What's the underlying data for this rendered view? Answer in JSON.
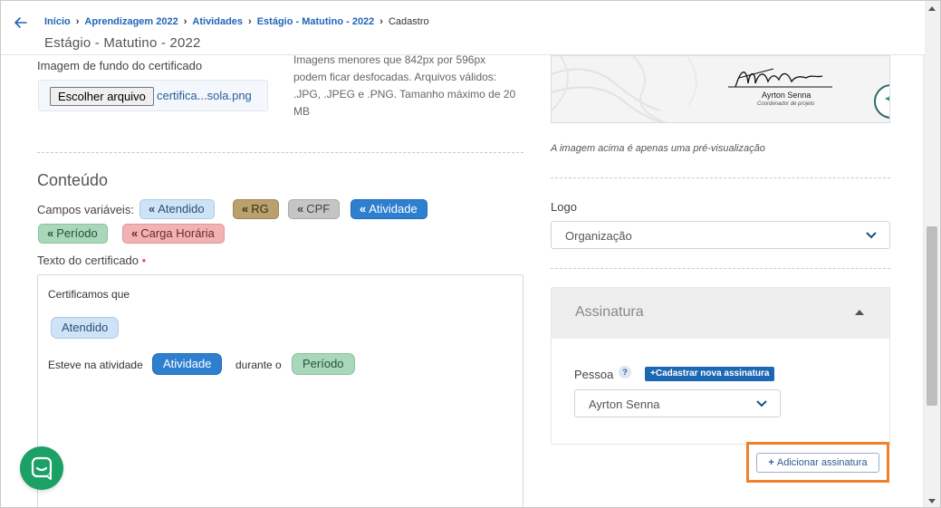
{
  "header": {
    "breadcrumb": [
      "Início",
      "Aprendizagem 2022",
      "Atividades",
      "Estágio - Matutino - 2022"
    ],
    "breadcrumb_current": "Cadastro",
    "title": "Estágio - Matutino - 2022"
  },
  "background_image": {
    "label": "Imagem de fundo do certificado",
    "button": "Escolher arquivo",
    "file_name": "certifica...sola.png",
    "hint": "Imagens menores que 842px por 596px podem ficar desfocadas. Arquivos válidos: .JPG, .JPEG e .PNG. Tamanho máximo de 20 MB"
  },
  "content": {
    "title": "Conteúdo",
    "variables_label": "Campos variáveis:",
    "variables": [
      {
        "label": "Atendido",
        "bg": "#cfe3f6",
        "fg": "#2c4f72",
        "border": "#a9c9e8"
      },
      {
        "label": "RG",
        "bg": "#b9a06d",
        "fg": "#3b2f17",
        "border": "#a08853"
      },
      {
        "label": "CPF",
        "bg": "#c5c5c5",
        "fg": "#444444",
        "border": "#aaaaaa"
      },
      {
        "label": "Atividade",
        "bg": "#2e7fd0",
        "fg": "#ffffff",
        "border": "#1f6bb8"
      },
      {
        "label": "Período",
        "bg": "#a8d8b9",
        "fg": "#26523a",
        "border": "#84c29c"
      },
      {
        "label": "Carga Horária",
        "bg": "#f0b2b2",
        "fg": "#6a2a2a",
        "border": "#dd9898"
      }
    ],
    "text_label": "Texto do certificado",
    "required_mark": "•",
    "editor": {
      "line1": "Certificamos que",
      "chip1": "Atendido",
      "line3_prefix": "Esteve na atividade",
      "chip2": "Atividade",
      "line3_middle": "durante o",
      "chip3": "Período"
    }
  },
  "preview": {
    "signature_name": "Ayrton Senna",
    "signature_role": "Coordenador de projeto",
    "caption": "A imagem acima é apenas uma pré-visualização"
  },
  "logo": {
    "label": "Logo",
    "value": "Organização"
  },
  "signature_panel": {
    "title": "Assinatura",
    "person_label": "Pessoa",
    "help": "?",
    "new_button": "Cadastrar nova assinatura",
    "person_value": "Ayrton Senna",
    "add_button": "Adicionar assinatura"
  },
  "colors": {
    "link": "#2165b8",
    "primary": "#1d68b4",
    "highlight": "#f0802a",
    "chat": "#1ba065",
    "required": "#e05555"
  },
  "icons": [
    "back-arrow-icon",
    "chevron-right-icon",
    "chevron-down-icon",
    "caret-up-icon",
    "plus-icon",
    "chat-icon",
    "double-chevron-left-icon"
  ]
}
